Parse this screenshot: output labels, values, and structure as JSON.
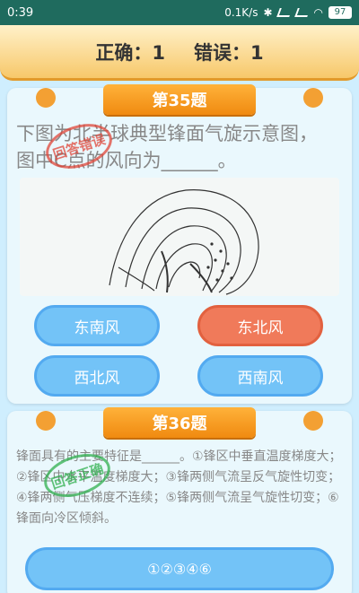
{
  "status_bar": {
    "time": "0:39",
    "net_speed": "0.1K/s",
    "battery": "97"
  },
  "score": {
    "correct_text": "正确：1",
    "wrong_text": "错误：1"
  },
  "question_35": {
    "title": "第35题",
    "text": "下图为北半球典型锋面气旋示意图，图中C点的风向为______。",
    "stamp": "回答错误",
    "options": [
      "东南风",
      "东北风",
      "西北风",
      "西南风"
    ],
    "selected_index": 1
  },
  "question_36": {
    "title": "第36题",
    "text": "锋面具有的主要特征是______。①锋区中垂直温度梯度大；②锋区中水平温度梯度大；③锋两侧气流呈反气旋性切变；④锋两侧气压梯度不连续；⑤锋两侧气流呈气旋性切变；⑥锋面向冷区倾斜。",
    "stamp": "回答正确",
    "options": [
      "①②③④⑥"
    ]
  },
  "colors": {
    "option_blue": "#73c3f7",
    "option_selected": "#f07a5a",
    "ribbon": "#f08a10",
    "stamp_wrong": "#e0473a",
    "stamp_right": "#31b04f"
  }
}
